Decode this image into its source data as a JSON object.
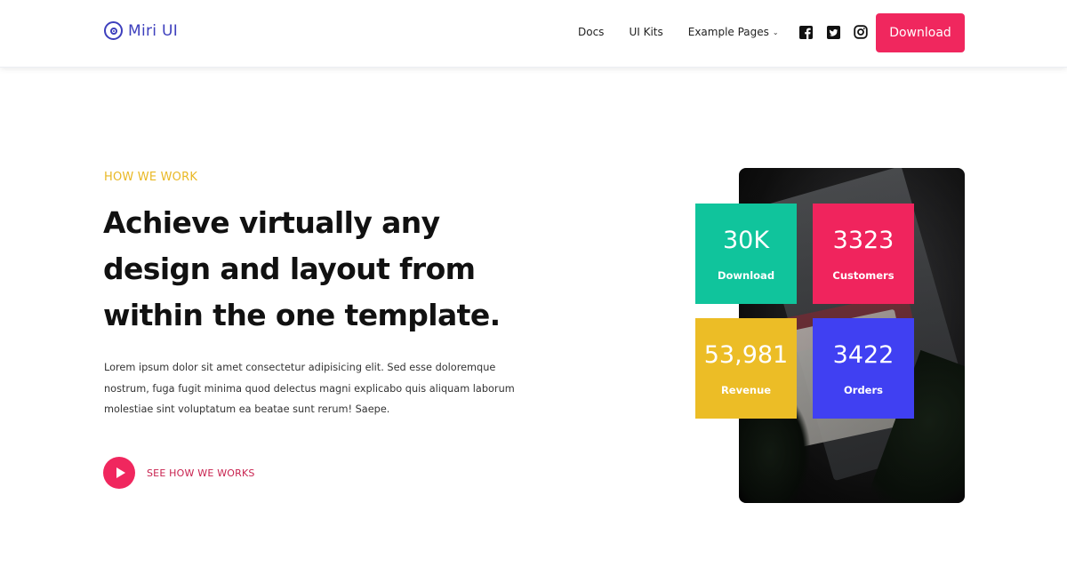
{
  "header": {
    "logo_text": "Miri UI",
    "nav": {
      "docs": "Docs",
      "ui_kits": "UI Kits",
      "example_pages": "Example Pages"
    },
    "social_icons": [
      "facebook-icon",
      "twitter-icon",
      "instagram-icon"
    ],
    "download_label": "Download"
  },
  "hero": {
    "eyebrow": "HOW WE WORK",
    "headline": "Achieve virtually any design and layout from within the one template.",
    "body": "Lorem ipsum dolor sit amet consectetur adipisicing elit. Sed esse doloremque nostrum, fuga fugit minima quod delectus magni explicabo quis aliquam laborum molestiae sint voluptatum ea beatae sunt rerum! Saepe.",
    "cta_label": "SEE HOW WE WORKS"
  },
  "stats": [
    {
      "value": "30K",
      "label": "Download",
      "color": "#10c49c"
    },
    {
      "value": "3323",
      "label": "Customers",
      "color": "#f0245d"
    },
    {
      "value": "53,981",
      "label": "Revenue",
      "color": "#ecbd26"
    },
    {
      "value": "3422",
      "label": "Orders",
      "color": "#4040f2"
    }
  ],
  "colors": {
    "brand": "#3d3fbd",
    "accent": "#f0275e",
    "eyebrow": "#e9b824"
  }
}
